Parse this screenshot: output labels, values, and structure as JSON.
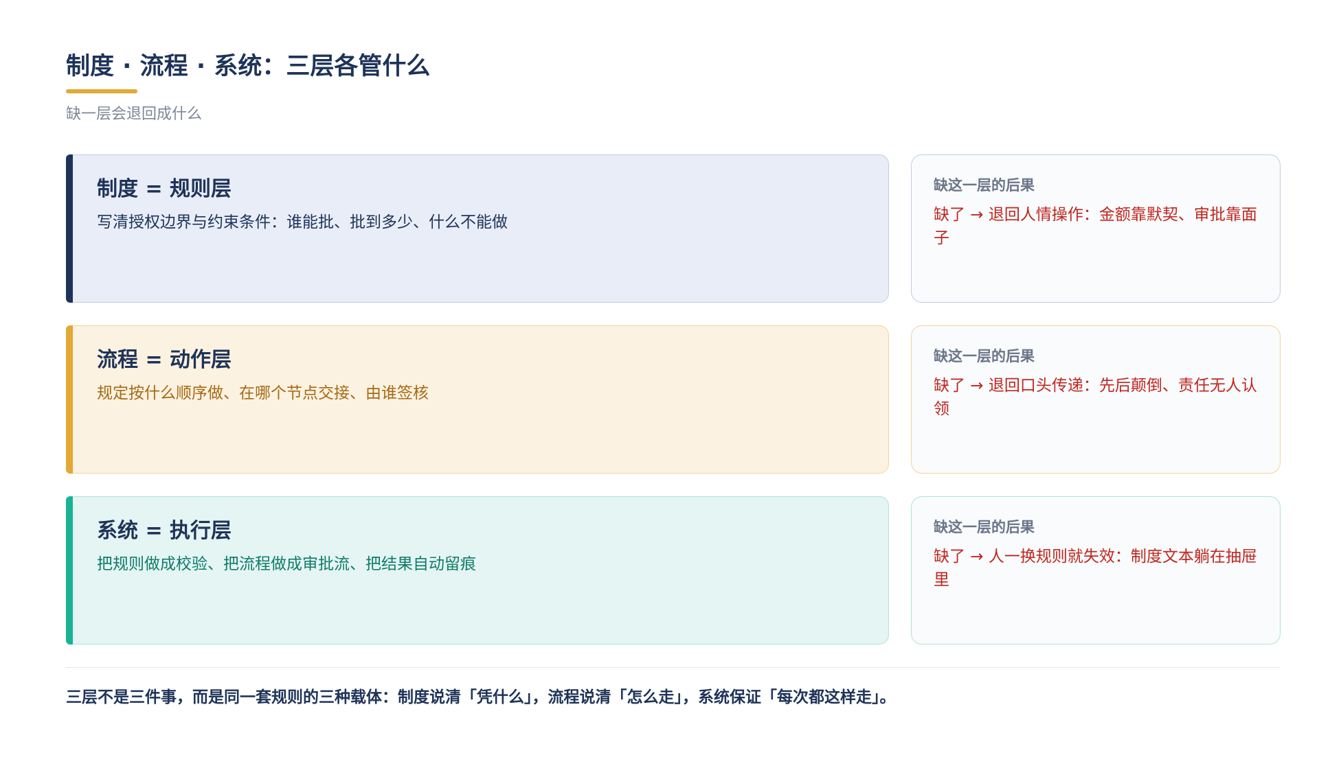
{
  "header": {
    "title": "制度 · 流程 · 系统：三层各管什么",
    "subtitle": "缺一层会退回成什么"
  },
  "layers": [
    {
      "name": "制度 = 规则层",
      "description": "写清授权边界与约束条件：谁能批、批到多少、什么不能做",
      "consequence_heading": "缺这一层的后果",
      "consequence": "缺了 → 退回人情操作：金额靠默契、审批靠面子",
      "colors": {
        "accent": "#1e3358",
        "fill": "#e8edf7",
        "border": "#c3cce0",
        "text": "#1e3358",
        "conseq_border": "#c3cce0"
      }
    },
    {
      "name": "流程 = 动作层",
      "description": "规定按什么顺序做、在哪个节点交接、由谁签核",
      "consequence_heading": "缺这一层的后果",
      "consequence": "缺了 → 退回口头传递：先后颠倒、责任无人认领",
      "colors": {
        "accent": "#e2a935",
        "fill": "#fcf2e1",
        "border": "#f3d49a",
        "text": "#a56a14",
        "conseq_border": "#f3d49a"
      }
    },
    {
      "name": "系统 = 执行层",
      "description": "把规则做成校验、把流程做成审批流、把结果自动留痕",
      "consequence_heading": "缺这一层的后果",
      "consequence": "缺了 → 人一换规则就失效：制度文本躺在抽屉里",
      "colors": {
        "accent": "#17b394",
        "fill": "#e4f5f3",
        "border": "#aee3da",
        "text": "#0f7c67",
        "conseq_border": "#aee3da"
      }
    }
  ],
  "footer": {
    "note": "三层不是三件事，而是同一套规则的三种载体：制度说清「凭什么」，流程说清「怎么走」，系统保证「每次都这样走」。"
  }
}
